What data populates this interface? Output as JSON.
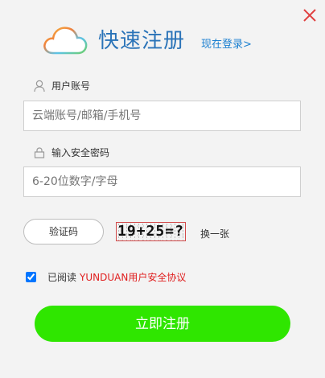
{
  "header": {
    "title": "快速注册",
    "login_link": "现在登录>"
  },
  "username": {
    "label": "用户账号",
    "placeholder": "云端账号/邮箱/手机号"
  },
  "password": {
    "label": "输入安全密码",
    "placeholder": "6-20位数字/字母"
  },
  "captcha": {
    "button_label": "验证码",
    "image_text": "19+25=?",
    "refresh_label": "换一张"
  },
  "agreement": {
    "checked": true,
    "prefix": "已阅读",
    "link_text": "YUNDUAN用户安全协议"
  },
  "submit_label": "立即注册",
  "colors": {
    "title": "#2a73b8",
    "link": "#1a7fd0",
    "submit": "#2fe600",
    "agreement_link": "#e02020",
    "close": "#e04040"
  }
}
